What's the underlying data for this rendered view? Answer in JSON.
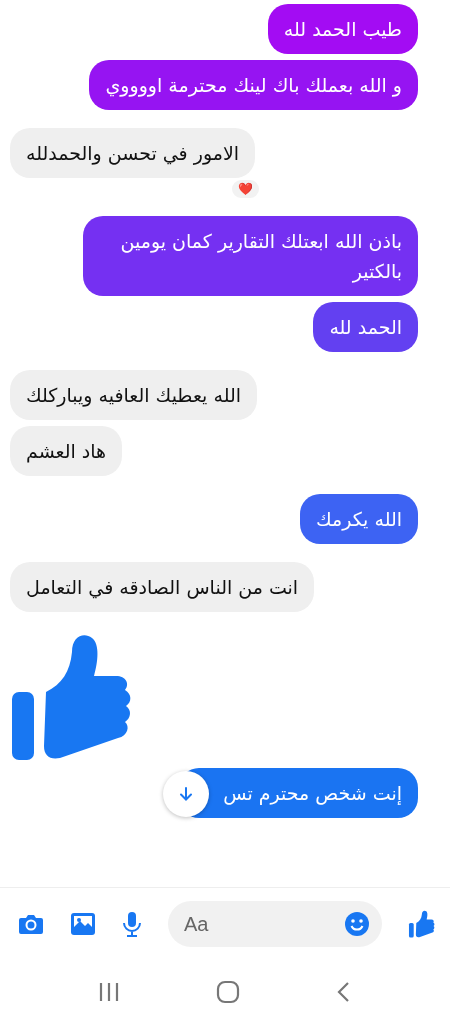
{
  "messages": [
    {
      "kind": "sent",
      "text": "طيب الحمد لله",
      "color": "#a30cf3"
    },
    {
      "kind": "sent",
      "text": "و الله بعملك باك لينك محترمة اووووي",
      "color": "#9614f2"
    },
    {
      "kind": "received",
      "text": "الامور في تحسن والحمدلله",
      "reaction": "❤️"
    },
    {
      "kind": "sent",
      "text": "باذن الله ابعتلك التقارير كمان يومين بالكتير",
      "color": "#7530f2"
    },
    {
      "kind": "sent",
      "text": "الحمد لله",
      "color": "#6340f1"
    },
    {
      "kind": "received",
      "text": "الله يعطيك العافيه ويباركلك"
    },
    {
      "kind": "received",
      "text": "هاد العشم"
    },
    {
      "kind": "sent",
      "text": "الله يكرمك",
      "color": "#3d63f3"
    },
    {
      "kind": "received",
      "text": "انت من الناس الصادقه في التعامل"
    },
    {
      "kind": "like"
    },
    {
      "kind": "sent",
      "text": "إنت شخص محترم تس",
      "color": "#1a74f2",
      "covered": true
    }
  ],
  "composer": {
    "placeholder": "Aa"
  }
}
